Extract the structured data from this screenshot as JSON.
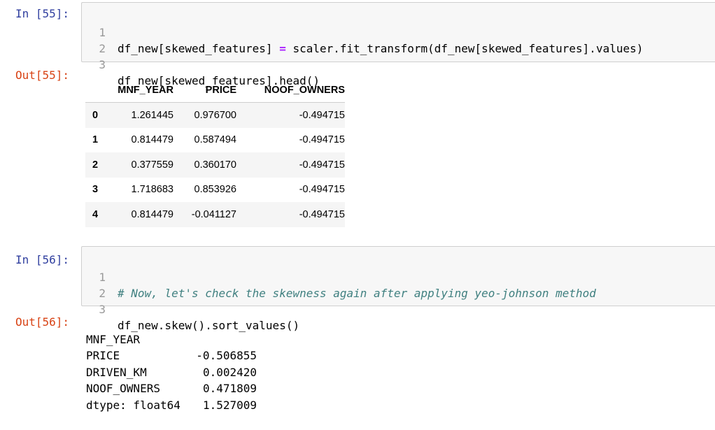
{
  "cells": [
    {
      "in_prompt": "In [55]:",
      "out_prompt": "Out[55]:",
      "code_lines": [
        {
          "num": "1",
          "parts": [
            {
              "t": "df_new[skewed_features] ",
              "c": ""
            },
            {
              "t": "=",
              "c": "op"
            },
            {
              "t": " scaler.fit_transform(df_new[skewed_features].values)",
              "c": ""
            }
          ]
        },
        {
          "num": "2",
          "parts": []
        },
        {
          "num": "3",
          "parts": [
            {
              "t": "df_new[skewed_features].head()",
              "c": ""
            }
          ]
        }
      ]
    },
    {
      "in_prompt": "In [56]:",
      "out_prompt": "Out[56]:",
      "code_lines": [
        {
          "num": "1",
          "parts": [
            {
              "t": "# Now, let's check the skewness again after applying yeo-johnson method",
              "c": "comment"
            }
          ]
        },
        {
          "num": "2",
          "parts": []
        },
        {
          "num": "3",
          "parts": [
            {
              "t": "df_new.skew().sort_values()",
              "c": ""
            }
          ]
        }
      ]
    }
  ],
  "dataframe": {
    "columns": [
      "",
      "MNF_YEAR",
      "PRICE",
      "NOOF_OWNERS"
    ],
    "rows": [
      {
        "index": "0",
        "values": [
          "1.261445",
          "0.976700",
          "-0.494715"
        ]
      },
      {
        "index": "1",
        "values": [
          "0.814479",
          "0.587494",
          "-0.494715"
        ]
      },
      {
        "index": "2",
        "values": [
          "0.377559",
          "0.360170",
          "-0.494715"
        ]
      },
      {
        "index": "3",
        "values": [
          "1.718683",
          "0.853926",
          "-0.494715"
        ]
      },
      {
        "index": "4",
        "values": [
          "0.814479",
          "-0.041127",
          "-0.494715"
        ]
      }
    ]
  },
  "series_output": {
    "rows": [
      {
        "key": "MNF_YEAR",
        "value": "-0.506855"
      },
      {
        "key": "PRICE",
        "value": "0.002420"
      },
      {
        "key": "DRIVEN_KM",
        "value": "0.471809"
      },
      {
        "key": "NOOF_OWNERS",
        "value": "1.527009"
      }
    ],
    "dtype_line": "dtype: float64"
  },
  "colors": {
    "in_prompt": "#303f9f",
    "out_prompt": "#d84315",
    "operator": "#aa22ff",
    "comment": "#408080",
    "code_background": "#f7f7f7"
  }
}
